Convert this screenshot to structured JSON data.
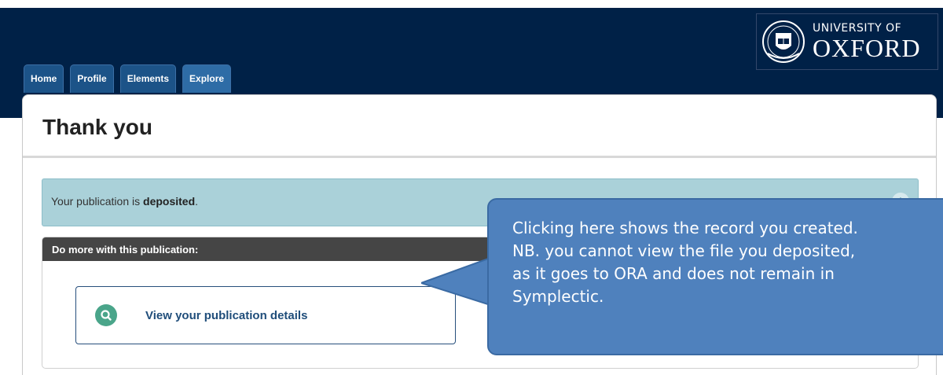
{
  "logo": {
    "line1": "UNIVERSITY OF",
    "line2": "OXFORD"
  },
  "nav": {
    "tabs": [
      "Home",
      "Profile",
      "Elements",
      "Explore"
    ]
  },
  "page": {
    "title": "Thank you"
  },
  "alert": {
    "prefix": "Your publication is ",
    "status": "deposited",
    "suffix": "."
  },
  "more": {
    "header": "Do more with this publication:",
    "button_label": "View your publication details"
  },
  "callout": {
    "lines": [
      "Clicking here shows the record you created.",
      "NB. you cannot view the file you deposited,",
      "as it goes to ORA and does not remain in",
      "Symplectic."
    ]
  },
  "colors": {
    "brand": "#002147",
    "tab": "#1c5388",
    "alert_bg": "#aad1d9",
    "callout_bg": "#4f81bd",
    "icon_green": "#4aa58a"
  }
}
